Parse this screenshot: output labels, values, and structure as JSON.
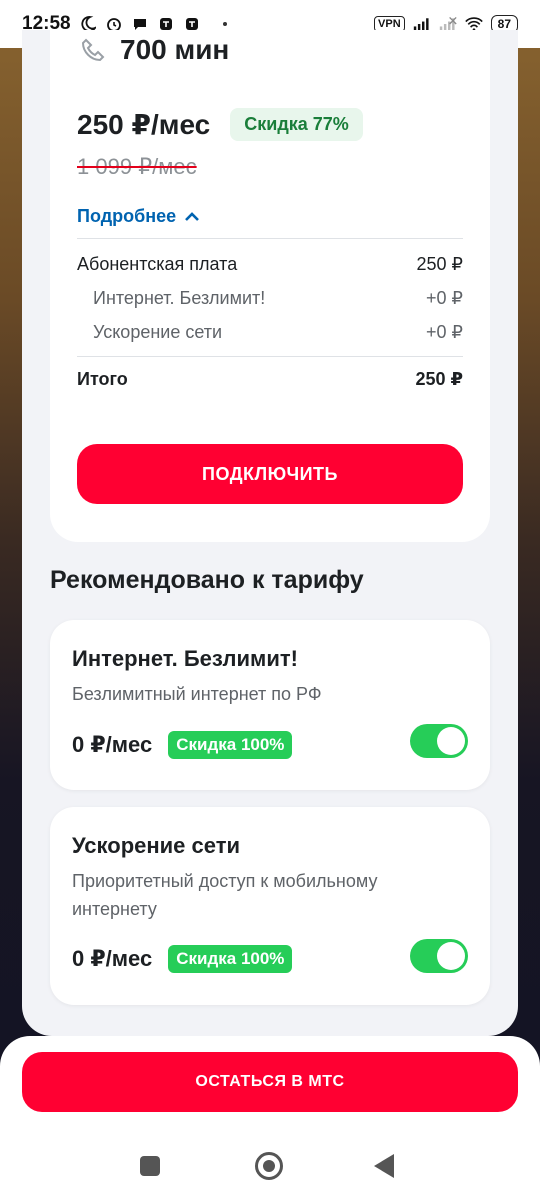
{
  "status_bar": {
    "time": "12:58",
    "left_icons": [
      "moon-icon",
      "alarm-icon",
      "message-icon",
      "chat-icon",
      "notification-icon",
      "notification-icon"
    ],
    "vpn_label": "VPN",
    "battery": "87"
  },
  "tariff": {
    "minutes": "700 мин",
    "price": "250 ₽/мес",
    "discount_badge": "Скидка 77%",
    "old_price": "1 099 ₽/мес",
    "details_link": "Подробнее",
    "breakdown": [
      {
        "label": "Абонентская плата",
        "value": "250 ₽"
      },
      {
        "label": "Интернет. Безлимит!",
        "value": "+0 ₽"
      },
      {
        "label": "Ускорение сети",
        "value": "+0 ₽"
      }
    ],
    "total_label": "Итого",
    "total_value": "250 ₽",
    "connect_button": "ПОДКЛЮЧИТЬ"
  },
  "recommended": {
    "title": "Рекомендовано к тарифу",
    "addons": [
      {
        "title": "Интернет. Безлимит!",
        "description": "Безлимитный интернет по РФ",
        "price": "0 ₽/мес",
        "badge": "Скидка 100%",
        "enabled": true
      },
      {
        "title": "Ускорение сети",
        "description": "Приоритетный доступ к мобильному интернету",
        "price": "0 ₽/мес",
        "badge": "Скидка 100%",
        "enabled": true
      }
    ]
  },
  "bottom": {
    "stay_button": "ОСТАТЬСЯ В МТС"
  },
  "colors": {
    "accent": "#ff0032",
    "link": "#0063b0",
    "success": "#26cd58"
  }
}
